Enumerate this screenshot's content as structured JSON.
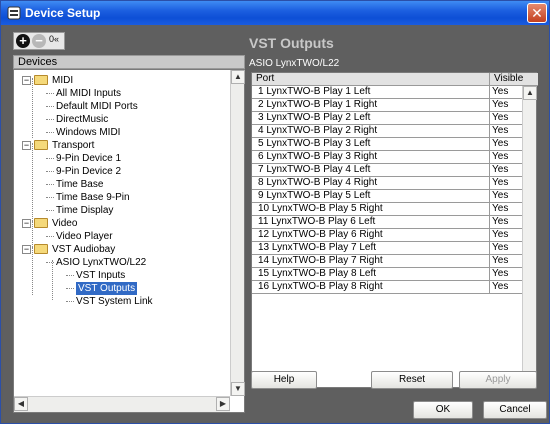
{
  "window": {
    "title": "Device Setup",
    "close_glyph": "✕"
  },
  "toolbar": {
    "add_glyph": "+",
    "remove_glyph": "−",
    "reset_label": "0«"
  },
  "devices": {
    "header": "Devices",
    "tree": [
      {
        "label": "MIDI",
        "type": "folder",
        "expander": "−"
      },
      {
        "label": "All MIDI Inputs",
        "type": "item"
      },
      {
        "label": "Default MIDI Ports",
        "type": "item"
      },
      {
        "label": "DirectMusic",
        "type": "item"
      },
      {
        "label": "Windows MIDI",
        "type": "item"
      },
      {
        "label": "Transport",
        "type": "folder",
        "expander": "−"
      },
      {
        "label": "9-Pin Device 1",
        "type": "item"
      },
      {
        "label": "9-Pin Device 2",
        "type": "item"
      },
      {
        "label": "Time Base",
        "type": "item"
      },
      {
        "label": "Time Base 9-Pin",
        "type": "item"
      },
      {
        "label": "Time Display",
        "type": "item"
      },
      {
        "label": "Video",
        "type": "folder",
        "expander": "−"
      },
      {
        "label": "Video Player",
        "type": "item"
      },
      {
        "label": "VST Audiobay",
        "type": "folder",
        "expander": "−"
      },
      {
        "label": "ASIO LynxTWO/L22",
        "type": "item"
      },
      {
        "label": "VST Inputs",
        "type": "item"
      },
      {
        "label": "VST Outputs",
        "type": "item",
        "selected": true
      },
      {
        "label": "VST System Link",
        "type": "item"
      }
    ]
  },
  "panel": {
    "title": "VST Outputs",
    "subtitle": "ASIO LynxTWO/L22",
    "columns": [
      "Port",
      "Visible"
    ],
    "rows": [
      {
        "port": "1 LynxTWO-B Play 1 Left",
        "visible": "Yes"
      },
      {
        "port": "2 LynxTWO-B Play 1 Right",
        "visible": "Yes"
      },
      {
        "port": "3 LynxTWO-B Play 2 Left",
        "visible": "Yes"
      },
      {
        "port": "4 LynxTWO-B Play 2 Right",
        "visible": "Yes"
      },
      {
        "port": "5 LynxTWO-B Play 3 Left",
        "visible": "Yes"
      },
      {
        "port": "6 LynxTWO-B Play 3 Right",
        "visible": "Yes"
      },
      {
        "port": "7 LynxTWO-B Play 4 Left",
        "visible": "Yes"
      },
      {
        "port": "8 LynxTWO-B Play 4 Right",
        "visible": "Yes"
      },
      {
        "port": "9 LynxTWO-B Play 5 Left",
        "visible": "Yes"
      },
      {
        "port": "10 LynxTWO-B Play 5 Right",
        "visible": "Yes"
      },
      {
        "port": "11 LynxTWO-B Play 6 Left",
        "visible": "Yes"
      },
      {
        "port": "12 LynxTWO-B Play 6 Right",
        "visible": "Yes"
      },
      {
        "port": "13 LynxTWO-B Play 7 Left",
        "visible": "Yes"
      },
      {
        "port": "14 LynxTWO-B Play 7 Right",
        "visible": "Yes"
      },
      {
        "port": "15 LynxTWO-B Play 8 Left",
        "visible": "Yes"
      },
      {
        "port": "16 LynxTWO-B Play 8 Right",
        "visible": "Yes"
      }
    ]
  },
  "buttons": {
    "help": "Help",
    "reset": "Reset",
    "apply": "Apply",
    "ok": "OK",
    "cancel": "Cancel"
  },
  "colors": {
    "titlebar": "#0d4fd6",
    "selection": "#316ac5",
    "dialog_bg": "#5f5f5f"
  }
}
